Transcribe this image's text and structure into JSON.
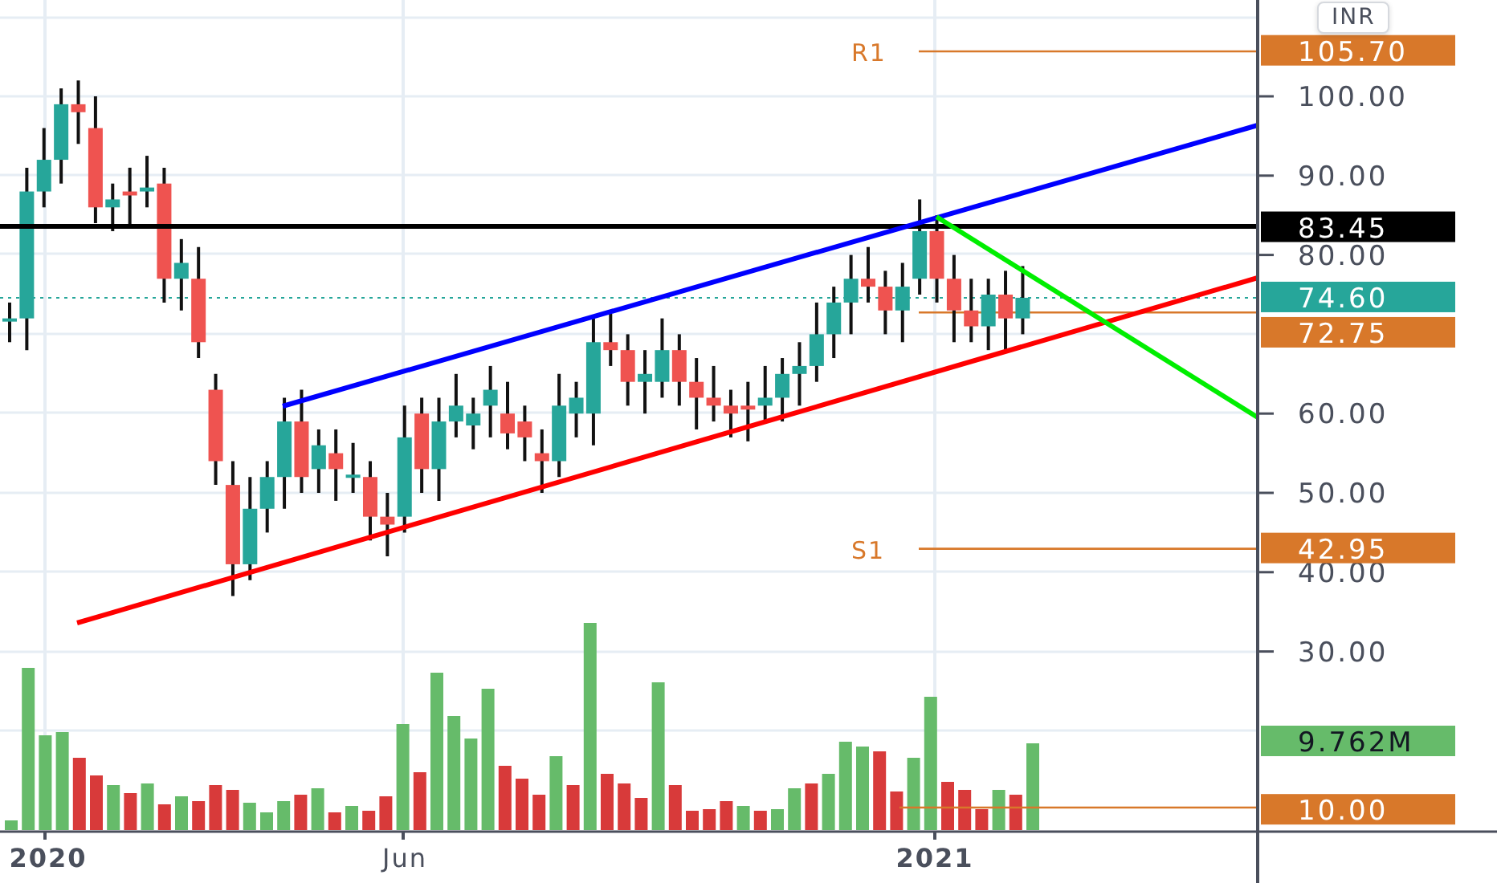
{
  "currency_button": {
    "label": "INR"
  },
  "price_axis": {
    "ticks": [
      "100.00",
      "90.00",
      "80.00",
      "60.00",
      "50.00",
      "40.00",
      "30.00"
    ]
  },
  "time_axis": {
    "labels": [
      "2020",
      "Jun",
      "2021"
    ]
  },
  "price_labels": [
    {
      "kind": "level",
      "name": "R1",
      "value": "105.70"
    },
    {
      "kind": "resistance",
      "value": "83.45"
    },
    {
      "kind": "last_price",
      "value": "74.60"
    },
    {
      "kind": "level",
      "value": "72.75"
    },
    {
      "kind": "level",
      "name": "S1",
      "value": "42.95"
    },
    {
      "kind": "volume",
      "value": "9.762M"
    },
    {
      "kind": "level",
      "value": "10.00"
    }
  ]
}
